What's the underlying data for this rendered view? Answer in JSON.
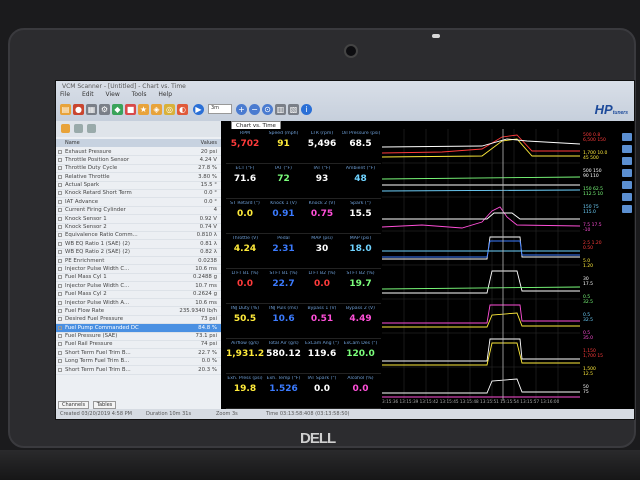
{
  "window": {
    "title": "VCM Scanner - [Untitled] - Chart vs. Time",
    "menu": [
      "File",
      "Edit",
      "View",
      "Tools",
      "Help"
    ],
    "zoom": "3m",
    "logo": "HP",
    "logo_sub": "tuners"
  },
  "left_panel": {
    "headers": {
      "name": "Name",
      "value": "Values"
    },
    "rows": [
      {
        "name": "Exhaust Pressure",
        "value": "20 psi"
      },
      {
        "name": "Throttle Position Sensor",
        "value": "4.24 V"
      },
      {
        "name": "Throttle Duty Cycle",
        "value": "27.8 %"
      },
      {
        "name": "Relative Throttle",
        "value": "3.80 %"
      },
      {
        "name": "Actual Spark",
        "value": "15.5 °"
      },
      {
        "name": "Knock Retard Short Term",
        "value": "0.0 °"
      },
      {
        "name": "IAT Advance",
        "value": "0.0 °"
      },
      {
        "name": "Current Firing Cylinder",
        "value": "4"
      },
      {
        "name": "Knock Sensor 1",
        "value": "0.92 V"
      },
      {
        "name": "Knock Sensor 2",
        "value": "0.74 V"
      },
      {
        "name": "Equivalence Ratio Comm...",
        "value": "0.810 λ"
      },
      {
        "name": "WB EQ Ratio 1 (SAE) (2)",
        "value": "0.81 λ"
      },
      {
        "name": "WB EQ Ratio 2 (SAE) (2)",
        "value": "0.82 λ"
      },
      {
        "name": "PE Enrichment",
        "value": "0.0238"
      },
      {
        "name": "Injector Pulse Width C...",
        "value": "10.6 ms"
      },
      {
        "name": "Fuel Mass Cyl 1",
        "value": "0.2488 g"
      },
      {
        "name": "Injector Pulse Width C...",
        "value": "10.7 ms"
      },
      {
        "name": "Fuel Mass Cyl 2",
        "value": "0.2624 g"
      },
      {
        "name": "Injector Pulse Width A...",
        "value": "10.6 ms"
      },
      {
        "name": "Fuel Flow Rate",
        "value": "235.9340 lb/h"
      },
      {
        "name": "Desired Fuel Pressure",
        "value": "73 psi"
      },
      {
        "name": "Fuel Pump Commanded DC",
        "value": "84.8 %",
        "selected": true
      },
      {
        "name": "Fuel Pressure (SAE)",
        "value": "73.1 psi"
      },
      {
        "name": "Fuel Rail Pressure",
        "value": "74 psi"
      },
      {
        "name": "Short Term Fuel Trim B...",
        "value": "22.7 %"
      },
      {
        "name": "Long Term Fuel Trim B...",
        "value": "0.0 %"
      },
      {
        "name": "Short Term Fuel Trim B...",
        "value": "20.3 %"
      }
    ],
    "tabs": [
      "Channels",
      "Tables"
    ]
  },
  "status": {
    "created": "Created 03/20/2019 4:58 PM",
    "duration": "Duration 10m 31s",
    "zoom": "Zoom 3s",
    "time": "Time 03:13:58:408 (03:13:58:50)"
  },
  "chart_tab": "Chart vs. Time",
  "gauges": [
    [
      {
        "label": "RPM",
        "value": "5,702",
        "color": "#ff3b3b"
      },
      {
        "label": "Speed (mph)",
        "value": "91",
        "color": "#ffeb3b"
      },
      {
        "label": "LTR (rpm)",
        "value": "5,496",
        "color": "#ffffff"
      },
      {
        "label": "Oil Pressure (psi)",
        "value": "68.5",
        "color": "#ffffff"
      }
    ],
    [
      {
        "label": "ECT (°F)",
        "value": "71.6",
        "color": "#ffffff"
      },
      {
        "label": "IAT (°F)",
        "value": "72",
        "color": "#7cff7c"
      },
      {
        "label": "IAT (°F)",
        "value": "93",
        "color": "#ffffff"
      },
      {
        "label": "Ambient (°F)",
        "value": "48",
        "color": "#6fd3ff"
      }
    ],
    [
      {
        "label": "ST Retard (°)",
        "value": "0.0",
        "color": "#ffeb3b"
      },
      {
        "label": "Knock 1 (V)",
        "value": "0.91",
        "color": "#3b7bff"
      },
      {
        "label": "Knock 2 (V)",
        "value": "0.75",
        "color": "#ff4fd8"
      },
      {
        "label": "Spark (°)",
        "value": "15.5",
        "color": "#ffffff"
      }
    ],
    [
      {
        "label": "Throttle (V)",
        "value": "4.24",
        "color": "#ffeb3b"
      },
      {
        "label": "Pedal",
        "value": "2.31",
        "color": "#3b7bff"
      },
      {
        "label": "MAP (psi)",
        "value": "30",
        "color": "#ffffff"
      },
      {
        "label": "MAP (psi)",
        "value": "18.0",
        "color": "#6fd3ff"
      }
    ],
    [
      {
        "label": "LTFT B1 (%)",
        "value": "0.0",
        "color": "#ff3b3b"
      },
      {
        "label": "STFT B1 (%)",
        "value": "22.7",
        "color": "#3b7bff"
      },
      {
        "label": "LTFT B2 (%)",
        "value": "0.0",
        "color": "#ff3b3b"
      },
      {
        "label": "STFT B2 (%)",
        "value": "19.7",
        "color": "#7cff7c"
      }
    ],
    [
      {
        "label": "INJ Duty (%)",
        "value": "50.5",
        "color": "#ffeb3b"
      },
      {
        "label": "INJ Puls (ms)",
        "value": "10.6",
        "color": "#3b7bff"
      },
      {
        "label": "Bypass 1 (V)",
        "value": "0.51",
        "color": "#ff4fd8"
      },
      {
        "label": "Bypass 2 (V)",
        "value": "4.49",
        "color": "#ff4fd8"
      }
    ],
    [
      {
        "label": "Airflow (g/s)",
        "value": "1,931.2",
        "color": "#ffeb3b"
      },
      {
        "label": "Total Air (g/s)",
        "value": "580.12",
        "color": "#ffffff"
      },
      {
        "label": "ExCam Ang (°)",
        "value": "119.6",
        "color": "#ffffff"
      },
      {
        "label": "ExCam Des (°)",
        "value": "120.0",
        "color": "#7cff7c"
      }
    ],
    [
      {
        "label": "Exh. Press (psi)",
        "value": "19.8",
        "color": "#ffeb3b"
      },
      {
        "label": "Exh. Temp (°F)",
        "value": "1.526",
        "color": "#3b7bff"
      },
      {
        "label": "IAT Spark (°)",
        "value": "0.0",
        "color": "#ffffff"
      },
      {
        "label": "Alcohol (%)",
        "value": "0.0",
        "color": "#ff4fd8"
      }
    ]
  ],
  "time_axis": "3:15:36 13:15:39 13:15:42 13:15:45 13:15:48 13:15:51 13:15:54 13:15:57 13:16:00",
  "right_panel": [
    [
      "500 0.8",
      "6,500 150"
    ],
    [
      "1,700 10.0",
      "45 500"
    ],
    [
      "500 150",
      "90 110"
    ],
    [
      "150 62.5",
      "112.5 10"
    ],
    [
      "150 75",
      "115.0"
    ],
    [
      "7.5 17.5",
      "-10"
    ],
    [
      "2.5 1.20",
      "0.50"
    ],
    [
      "5.0",
      "1.20"
    ],
    [
      "30",
      "17.5"
    ],
    [
      "0.5",
      "32.5"
    ],
    [
      "0.5",
      "32.5"
    ],
    [
      "0.5",
      "35.0"
    ],
    [
      "1,150",
      "1,700 15"
    ],
    [
      "1,500",
      "12.5"
    ],
    [
      "50",
      "75"
    ]
  ]
}
